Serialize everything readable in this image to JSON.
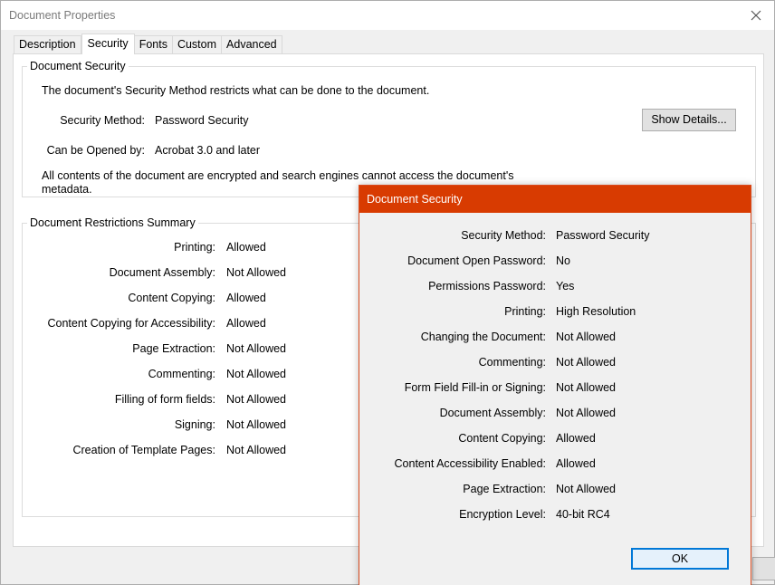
{
  "window": {
    "title": "Document Properties"
  },
  "tabs": [
    {
      "label": "Description"
    },
    {
      "label": "Security"
    },
    {
      "label": "Fonts"
    },
    {
      "label": "Custom"
    },
    {
      "label": "Advanced"
    }
  ],
  "document_security": {
    "group_label": "Document Security",
    "intro": "The document's Security Method restricts what can be done to the document.",
    "method_label": "Security Method:",
    "method_value": "Password Security",
    "show_details_label": "Show Details...",
    "opened_by_label": "Can be Opened by:",
    "opened_by_value": "Acrobat 3.0 and later",
    "note_line1": "All contents of the document are encrypted and search engines cannot access the document's",
    "note_line2": "metadata."
  },
  "restrictions": {
    "group_label": "Document Restrictions Summary",
    "rows": [
      {
        "label": "Printing:",
        "value": "Allowed"
      },
      {
        "label": "Document Assembly:",
        "value": "Not Allowed"
      },
      {
        "label": "Content Copying:",
        "value": "Allowed"
      },
      {
        "label": "Content Copying for Accessibility:",
        "value": "Allowed"
      },
      {
        "label": "Page Extraction:",
        "value": "Not Allowed"
      },
      {
        "label": "Commenting:",
        "value": "Not Allowed"
      },
      {
        "label": "Filling of form fields:",
        "value": "Not Allowed"
      },
      {
        "label": "Signing:",
        "value": "Not Allowed"
      },
      {
        "label": "Creation of Template Pages:",
        "value": "Not Allowed"
      }
    ]
  },
  "dialog": {
    "title": "Document Security",
    "accent_color": "#d83b01",
    "rows": [
      {
        "label": "Security Method:",
        "value": "Password Security"
      },
      {
        "label": "Document Open Password:",
        "value": "No"
      },
      {
        "label": "Permissions Password:",
        "value": "Yes"
      },
      {
        "label": "Printing:",
        "value": "High Resolution"
      },
      {
        "label": "Changing the Document:",
        "value": "Not Allowed"
      },
      {
        "label": "Commenting:",
        "value": "Not Allowed"
      },
      {
        "label": "Form Field Fill-in or Signing:",
        "value": "Not Allowed"
      },
      {
        "label": "Document Assembly:",
        "value": "Not Allowed"
      },
      {
        "label": "Content Copying:",
        "value": "Allowed"
      },
      {
        "label": "Content Accessibility Enabled:",
        "value": "Allowed"
      },
      {
        "label": "Page Extraction:",
        "value": "Not Allowed"
      },
      {
        "label": "Encryption Level:",
        "value": "40-bit RC4"
      }
    ],
    "ok_label": "OK"
  },
  "icons": {
    "close": "close-icon"
  }
}
